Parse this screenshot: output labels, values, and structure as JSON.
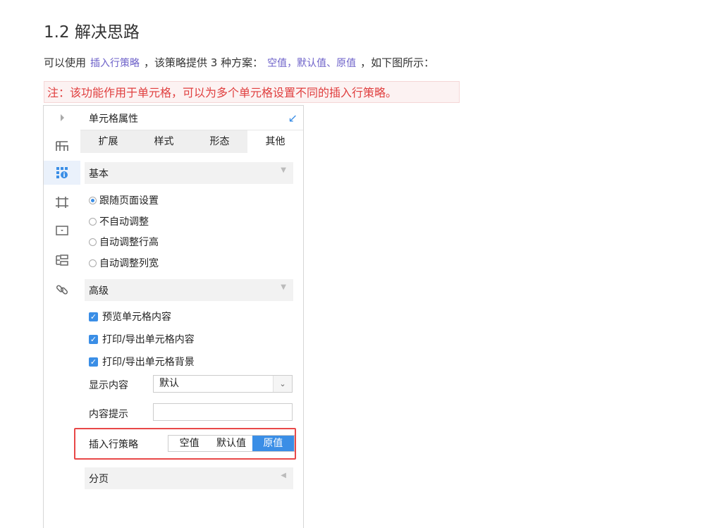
{
  "heading": "1.2 解决思路",
  "intro": {
    "prefix": "可以使用",
    "link1": "插入行策略",
    "middle": "，该策略提供 3 种方案：",
    "link2": "空值，默认值、原值",
    "suffix": "，如下图所示："
  },
  "note": "注：该功能作用于单元格，可以为多个单元格设置不同的插入行策略。",
  "panel": {
    "title": "单元格属性",
    "tabs": [
      "扩展",
      "样式",
      "形态",
      "其他"
    ],
    "active_tab": "其他",
    "basic": {
      "label": "基本",
      "options": [
        "跟随页面设置",
        "不自动调整",
        "自动调整行高",
        "自动调整列宽"
      ],
      "selected": "跟随页面设置"
    },
    "advanced": {
      "label": "高级",
      "checks": [
        "预览单元格内容",
        "打印/导出单元格内容",
        "打印/导出单元格背景"
      ],
      "display_label": "显示内容",
      "display_value": "默认",
      "tip_label": "内容提示",
      "tip_value": "",
      "insert_label": "插入行策略",
      "insert_options": [
        "空值",
        "默认值",
        "原值"
      ],
      "insert_selected": "原值"
    },
    "paging": {
      "label": "分页"
    }
  },
  "toolbar_icons": [
    "expand-arrow-icon",
    "cell-element-icon",
    "cell-attribute-icon",
    "cell-style-icon",
    "widget-icon",
    "condition-icon",
    "hyperlink-icon"
  ],
  "colors": {
    "accent": "#3a8ee6",
    "link": "#6d61c9",
    "note_text": "#e03f3f",
    "highlight": "#e84848"
  }
}
